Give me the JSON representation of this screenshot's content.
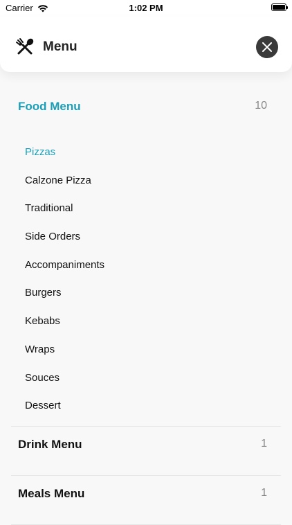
{
  "status_bar": {
    "carrier": "Carrier",
    "time": "1:02 PM",
    "icons": [
      "wifi-icon",
      "battery-icon"
    ]
  },
  "header": {
    "title": "Menu",
    "icon": "fork-spoon-icon",
    "close_icon": "close-icon"
  },
  "colors": {
    "accent": "#1b9fb8",
    "close_button": "#3a3a3a",
    "count_gray": "#888888"
  },
  "categories": [
    {
      "title": "Food Menu",
      "count": "10",
      "expanded": true,
      "items": [
        {
          "label": "Pizzas",
          "active": true
        },
        {
          "label": "Calzone Pizza"
        },
        {
          "label": "Traditional"
        },
        {
          "label": "Side Orders"
        },
        {
          "label": "Accompaniments"
        },
        {
          "label": "Burgers"
        },
        {
          "label": "Kebabs"
        },
        {
          "label": "Wraps"
        },
        {
          "label": "Souces"
        },
        {
          "label": "Dessert"
        }
      ]
    },
    {
      "title": "Drink Menu",
      "count": "1"
    },
    {
      "title": "Meals Menu",
      "count": "1"
    }
  ]
}
